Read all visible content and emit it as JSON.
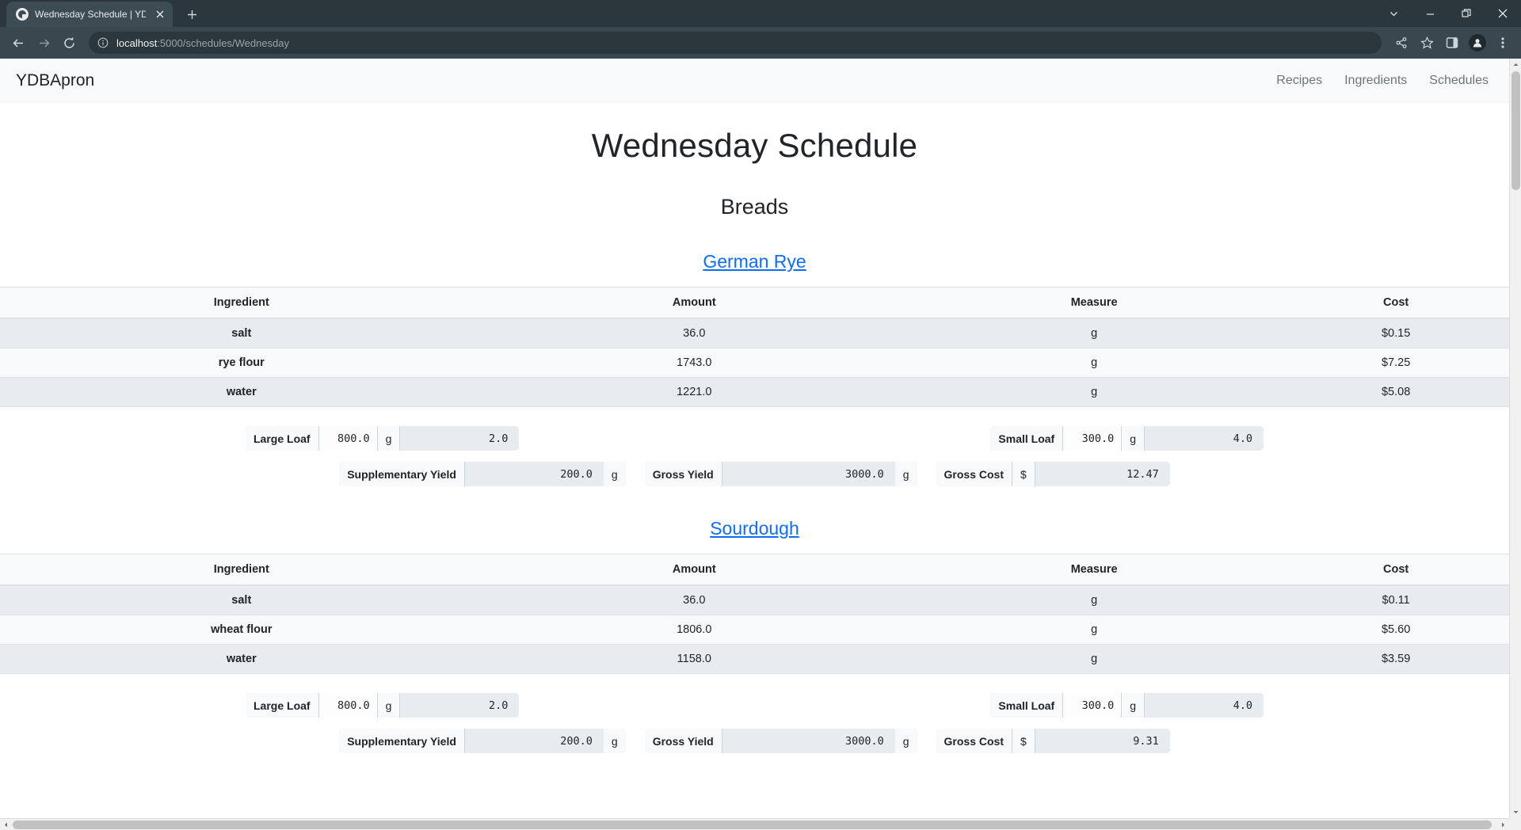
{
  "browser": {
    "tab": {
      "title": "Wednesday Schedule | YDB",
      "favicon_icon": "globe-icon",
      "close_icon": "close-icon"
    },
    "new_tab_label": "+",
    "window_controls": {
      "list_icon": "chevron-down-icon",
      "minimize_icon": "minimize-icon",
      "maximize_icon": "restore-icon",
      "close_icon": "close-icon"
    },
    "nav": {
      "back_icon": "back-arrow-icon",
      "forward_icon": "forward-arrow-icon",
      "reload_icon": "reload-icon"
    },
    "omnibox": {
      "info_icon": "info-circle-icon",
      "host": "localhost",
      "rest": ":5000/schedules/Wednesday",
      "full_url": "localhost:5000/schedules/Wednesday"
    },
    "toolbar_icons": [
      "share-icon",
      "star-icon",
      "side-panel-icon",
      "profile-avatar-icon",
      "three-dot-menu-icon"
    ]
  },
  "site": {
    "brand": "YDBApron",
    "nav_links": [
      {
        "label": "Recipes"
      },
      {
        "label": "Ingredients"
      },
      {
        "label": "Schedules"
      }
    ]
  },
  "page": {
    "title": "Wednesday Schedule",
    "section_title": "Breads"
  },
  "table_headers": [
    "Ingredient",
    "Amount",
    "Measure",
    "Cost"
  ],
  "recipes": [
    {
      "name": "German Rye",
      "ingredients": [
        {
          "ingredient": "salt",
          "amount": "36.0",
          "measure": "g",
          "cost": "$0.15"
        },
        {
          "ingredient": "rye flour",
          "amount": "1743.0",
          "measure": "g",
          "cost": "$7.25"
        },
        {
          "ingredient": "water",
          "amount": "1221.0",
          "measure": "g",
          "cost": "$5.08"
        }
      ],
      "large_loaf": {
        "label": "Large Loaf",
        "size": "800.0",
        "unit": "g",
        "count": "2.0"
      },
      "small_loaf": {
        "label": "Small Loaf",
        "size": "300.0",
        "unit": "g",
        "count": "4.0"
      },
      "supplementary": {
        "label": "Supplementary Yield",
        "value": "200.0",
        "unit": "g"
      },
      "gross_yield": {
        "label": "Gross Yield",
        "value": "3000.0",
        "unit": "g"
      },
      "gross_cost": {
        "label": "Gross Cost",
        "currency": "$",
        "value": "12.47"
      }
    },
    {
      "name": "Sourdough",
      "ingredients": [
        {
          "ingredient": "salt",
          "amount": "36.0",
          "measure": "g",
          "cost": "$0.11"
        },
        {
          "ingredient": "wheat flour",
          "amount": "1806.0",
          "measure": "g",
          "cost": "$5.60"
        },
        {
          "ingredient": "water",
          "amount": "1158.0",
          "measure": "g",
          "cost": "$3.59"
        }
      ],
      "large_loaf": {
        "label": "Large Loaf",
        "size": "800.0",
        "unit": "g",
        "count": "2.0"
      },
      "small_loaf": {
        "label": "Small Loaf",
        "size": "300.0",
        "unit": "g",
        "count": "4.0"
      },
      "supplementary": {
        "label": "Supplementary Yield",
        "value": "200.0",
        "unit": "g"
      },
      "gross_yield": {
        "label": "Gross Yield",
        "value": "3000.0",
        "unit": "g"
      },
      "gross_cost": {
        "label": "Gross Cost",
        "currency": "$",
        "value": "9.31"
      }
    }
  ],
  "colors": {
    "link": "#0d6efd",
    "chrome": "#2b373c",
    "toolbar": "#3b474e",
    "navbar_bg": "#f8f9fa",
    "row_stripe": "#e9ecef"
  }
}
